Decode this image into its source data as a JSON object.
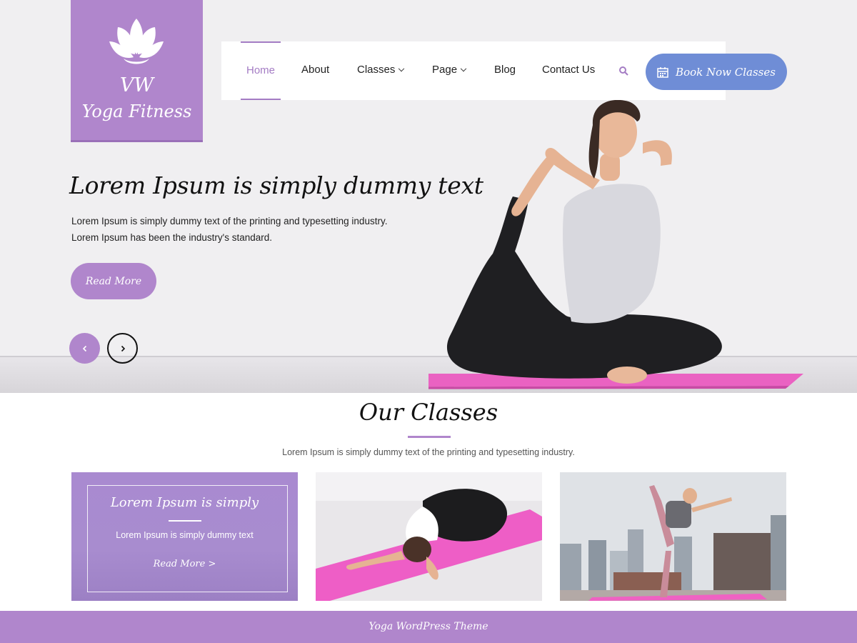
{
  "brand": {
    "line1": "VW",
    "line2": "Yoga Fitness",
    "icon": "lotus-icon"
  },
  "nav": {
    "items": [
      {
        "label": "Home",
        "active": true
      },
      {
        "label": "About",
        "active": false
      },
      {
        "label": "Classes",
        "active": false,
        "dropdown": true
      },
      {
        "label": "Page",
        "active": false,
        "dropdown": true
      },
      {
        "label": "Blog",
        "active": false
      },
      {
        "label": "Contact Us",
        "active": false
      }
    ],
    "search_icon": "search-icon",
    "book_label": "Book Now Classes",
    "book_icon": "calendar-icon"
  },
  "hero": {
    "title": "Lorem Ipsum is simply dummy text",
    "text_line1": "Lorem Ipsum is simply dummy text of the printing and typesetting industry.",
    "text_line2": "Lorem Ipsum has been the industry's standard.",
    "read_more": "Read More"
  },
  "classes": {
    "title": "Our Classes",
    "subtitle": "Lorem Ipsum is simply dummy text of the printing and typesetting industry.",
    "featured": {
      "title": "Lorem Ipsum is simply",
      "text": "Lorem Ipsum is simply dummy text",
      "link": "Read More >"
    }
  },
  "footer": {
    "text": "Yoga WordPress Theme"
  },
  "colors": {
    "primary": "#b086cc",
    "button_blue": "#6f8dd6",
    "mat_pink": "#e95fbf"
  }
}
